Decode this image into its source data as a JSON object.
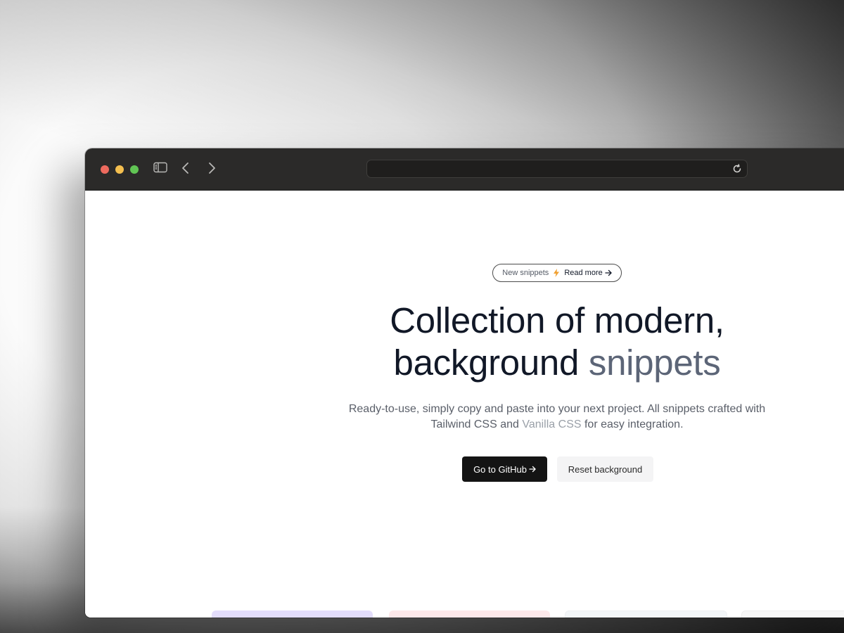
{
  "browser": {
    "address_value": ""
  },
  "hero": {
    "badge": {
      "text": "New snippets",
      "link": "Read more"
    },
    "headline": {
      "line1": "Collection of modern,",
      "line2_plain": "background",
      "line2_accent": "snippets"
    },
    "subtitle": {
      "part1": "Ready-to-use, simply copy and paste into your next project. All snippets crafted with Tailwind CSS and",
      "highlight": "Vanilla CSS",
      "part2": "for easy integration."
    },
    "buttons": {
      "primary": "Go to GitHub",
      "secondary": "Reset background"
    }
  },
  "icons": {
    "badge": "lightning-bolt-icon",
    "arrow": "arrow-right-icon",
    "sidebar": "sidebar-toggle-icon",
    "back": "chevron-left-icon",
    "forward": "chevron-right-icon",
    "reload": "reload-icon"
  },
  "colors": {
    "titlebar": "#2b2a29",
    "bolt": "#f0a030",
    "primary_button": "#141414",
    "headline": "#111827",
    "headline_accent": "#5c6577",
    "card_tints": [
      "#e3ddfb",
      "#fde8ea",
      "#f3f6f8",
      "#f7f7f7"
    ]
  }
}
